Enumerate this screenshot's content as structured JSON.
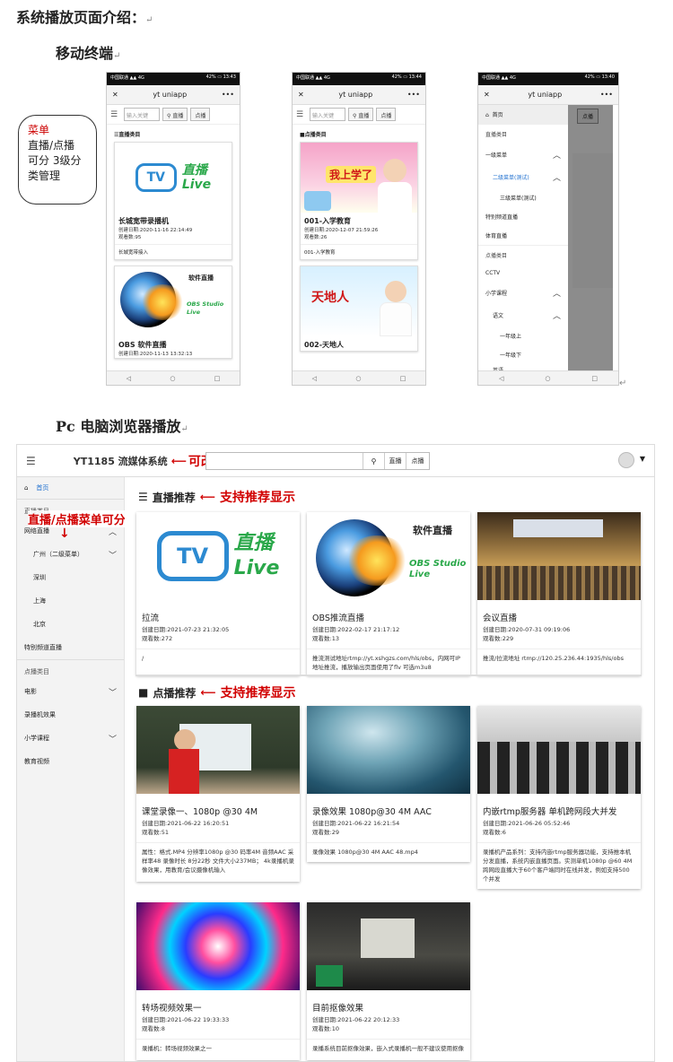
{
  "heading": "系统播放页面介绍：",
  "mobile_heading": "移动终端",
  "pc_heading": "Pc 电脑浏览器播放",
  "return_mark": "↵",
  "callout": {
    "l1": "菜单",
    "l2": "直播/点播",
    "l3": "可分 3级分",
    "l4": "类管理"
  },
  "phone": {
    "status_left": "中国联通 ▲▲ 4G",
    "status_right_1": "42% ▭ 13:43",
    "status_right_2": "42% ▭ 13:44",
    "status_right_3": "42% ▭ 13:40",
    "title": "yt uniapp",
    "search_placeholder": "输入关键",
    "live_btn": "直播",
    "vod_btn": "点播",
    "live_sec": "直播类目",
    "vod_sec": "点播类目",
    "card1_title": "长城宽带录播机",
    "card1_date": "创建日期:2020-11-16 22:14:49",
    "card1_views": "观看数:95",
    "card1_desc": "长城宽带接入",
    "card2_title": "OBS 软件直播",
    "card2_date": "创建日期:2020-11-13 13:32:13",
    "vod1_title": "001-入学教育",
    "vod1_date": "创建日期:2020-12-07 21:59:26",
    "vod1_views": "观看数:26",
    "vod1_desc": "001-入学教育",
    "vod2_title": "002-天地人",
    "vod1_banner": "我上学了",
    "vod2_banner": "天地人",
    "tv": "TV",
    "live_a": "直播",
    "live_b": "Live",
    "soft_live": "软件直播",
    "obs_a": "OBS Studio",
    "obs_b": "Live"
  },
  "drawer": {
    "home": "首页",
    "live_cat": "直播类目",
    "level1": "一级菜单",
    "level2": "二级菜单(测试)",
    "level3": "三级菜单(测试)",
    "special": "特别频道直播",
    "sports": "体育直播",
    "vod_cat": "点播类目",
    "cctv": "CCTV",
    "primary": "小学课程",
    "chinese": "语文",
    "g1a": "一年级上",
    "g1b": "一年级下",
    "more": "英语"
  },
  "pc": {
    "system_name": "YT1185 流媒体系统",
    "system_anno": "可改系统信息",
    "live_btn": "直播",
    "vod_btn": "点播",
    "home": "首页",
    "live_cat": "直播类目",
    "net_live": "网络直播",
    "guangzhou": "广州（二级菜单）",
    "shenzhen": "深圳",
    "shanghai": "上海",
    "beijing": "北京",
    "special": "特别频道直播",
    "vod_cat": "点播类目",
    "movie": "电影",
    "recorder": "录播机效果",
    "primary": "小学课程",
    "edu": "教育视频",
    "menu_anno": "直播/点播菜单可分1至3级管理",
    "live_rec": "直播推荐",
    "vod_rec": "点播推荐",
    "rec_anno": "支持推荐显示",
    "live_cards": [
      {
        "title": "拉流",
        "date": "创建日期:2021-07-23 21:32:05",
        "views": "观看数:272",
        "desc": "/"
      },
      {
        "title": "OBS推流直播",
        "date": "创建日期:2022-02-17 21:17:12",
        "views": "观看数:13",
        "desc": "推流测试地址rtmp://yt.xshgzs.com/hls/obs，内网可IP地址推流，播放输出页面使用了flv 可选m3u8"
      },
      {
        "title": "会议直播",
        "date": "创建日期:2020-07-31 09:19:06",
        "views": "观看数:229",
        "desc": "推流/拉流地址 rtmp://120.25.236.44:1935/hls/obs"
      }
    ],
    "vod_cards": [
      {
        "title": "课堂录像一、1080p @30 4M",
        "date": "创建日期:2021-06-22 16:20:51",
        "views": "观看数:51",
        "desc": "属性：格式.MP4 分辨率1080p @30 码率4M 音频AAC 采样率48 录像时长 8分22秒 文件大小237MB； 4k录播机录像效果，用教育/会议摄像机输入"
      },
      {
        "title": "录像效果 1080p@30 4M AAC",
        "date": "创建日期:2021-06-22 16:21:54",
        "views": "观看数:29",
        "desc": "录像效果 1080p@30 4M AAC 48.mp4"
      },
      {
        "title": "内嵌rtmp服务器 单机跨网段大并发",
        "date": "创建日期:2021-06-26 05:52:46",
        "views": "观看数:6",
        "desc": "录播机产品系列：支持内嵌rtmp服务器功能，支持推本机分发直播，系统内嵌直播页面。实测单机1080p @60 4M 跨网段直播大于60个客户端同时在线并发，例如支持500个并发"
      },
      {
        "title": "转场视频效果一",
        "date": "创建日期:2021-06-22 19:33:33",
        "views": "观看数:8",
        "desc": "录播机：转场视频效果之一"
      },
      {
        "title": "目前抠像效果",
        "date": "创建日期:2021-06-22 20:12:33",
        "views": "观看数:10",
        "desc": "录播系统目前抠像效果，嵌入式录播机一般不建议使用抠像"
      }
    ]
  }
}
